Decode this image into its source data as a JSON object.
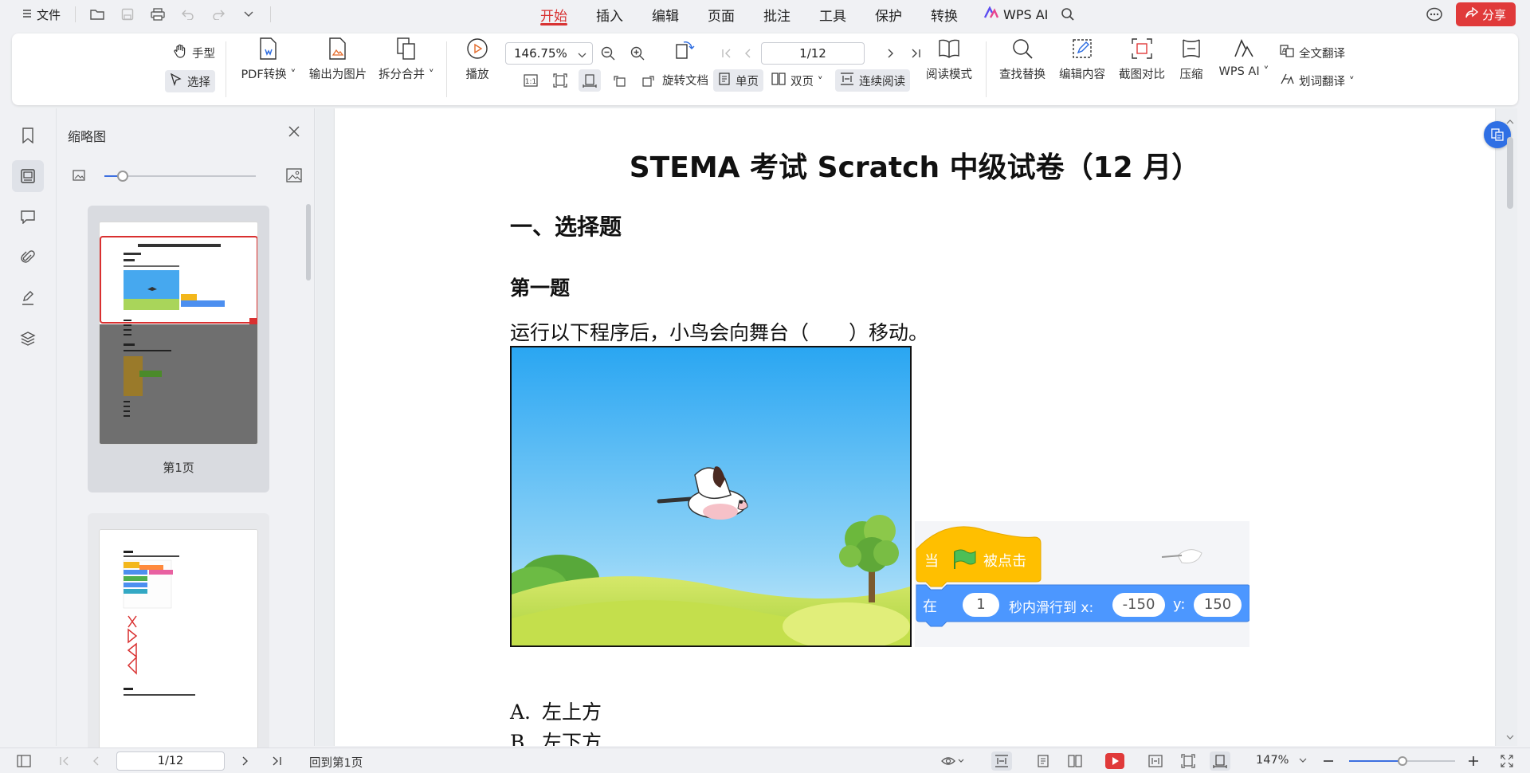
{
  "titlebar": {
    "file_label": "文件",
    "menu": [
      "开始",
      "插入",
      "编辑",
      "页面",
      "批注",
      "工具",
      "保护",
      "转换"
    ],
    "active_menu": "开始",
    "ai_label": "WPS AI",
    "share_label": "分享",
    "accent_color": "#d83232"
  },
  "ribbon": {
    "hand_label": "手型",
    "select_label": "选择",
    "pdf_convert": "PDF转换",
    "export_image": "输出为图片",
    "split_merge": "拆分合并",
    "play": "播放",
    "zoom": "146.75%",
    "page": "1/12",
    "rotate": "旋转文档",
    "single_page": "单页",
    "double_page": "双页",
    "continuous": "连续阅读",
    "read_mode": "阅读模式",
    "find_replace": "查找替换",
    "edit_content": "编辑内容",
    "screenshot_compare": "截图对比",
    "compress": "压缩",
    "wps_ai": "WPS AI",
    "full_translate": "全文翻译",
    "word_translate": "划词翻译"
  },
  "thumbnails": {
    "title": "缩略图",
    "page1_label": "第1页",
    "slider_level": 0.12
  },
  "document": {
    "title": "STEMA 考试 Scratch 中级试卷（12 月）",
    "section": "一、选择题",
    "question_title": "第一题",
    "question_text": "运行以下程序后，小鸟会向舞台（　　）移动。",
    "code": {
      "event_when": "当",
      "event_clicked": "被点击",
      "motion_in": "在",
      "secs": "1",
      "motion_text": "秒内滑行到 x:",
      "x": "-150",
      "y_label": "y:",
      "y": "150"
    },
    "options": [
      {
        "letter": "A.",
        "text": "左上方"
      },
      {
        "letter": "B.",
        "text": "左下方"
      }
    ]
  },
  "statusbar": {
    "page": "1/12",
    "back_label": "回到第1页",
    "zoom": "147%",
    "zoom_level": 0.5
  }
}
